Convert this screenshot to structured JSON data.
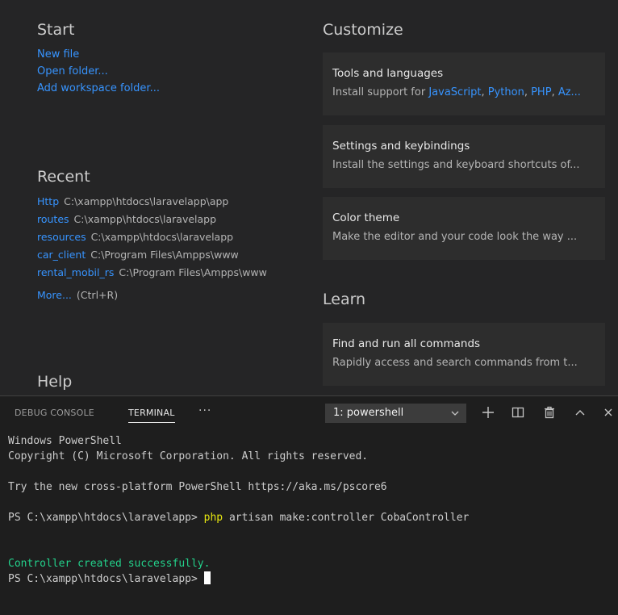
{
  "welcome": {
    "start": {
      "title": "Start",
      "links": [
        "New file",
        "Open folder...",
        "Add workspace folder..."
      ]
    },
    "recent": {
      "title": "Recent",
      "items": [
        {
          "name": "Http",
          "path": "C:\\xampp\\htdocs\\laravelapp\\app"
        },
        {
          "name": "routes",
          "path": "C:\\xampp\\htdocs\\laravelapp"
        },
        {
          "name": "resources",
          "path": "C:\\xampp\\htdocs\\laravelapp"
        },
        {
          "name": "car_client",
          "path": "C:\\Program Files\\Ampps\\www"
        },
        {
          "name": "rental_mobil_rs",
          "path": "C:\\Program Files\\Ampps\\www"
        }
      ],
      "more_label": "More...",
      "more_shortcut": "(Ctrl+R)"
    },
    "help": {
      "title": "Help"
    },
    "customize": {
      "title": "Customize",
      "cards": {
        "tools": {
          "title": "Tools and languages",
          "desc_prefix": "Install support for ",
          "links": [
            "JavaScript",
            "Python",
            "PHP",
            "Az..."
          ]
        },
        "settings": {
          "title": "Settings and keybindings",
          "desc": "Install the settings and keyboard shortcuts of..."
        },
        "theme": {
          "title": "Color theme",
          "desc": "Make the editor and your code look the way ..."
        }
      }
    },
    "learn": {
      "title": "Learn",
      "cards": {
        "commands": {
          "title": "Find and run all commands",
          "desc": "Rapidly access and search commands from t..."
        }
      }
    }
  },
  "panel": {
    "tabs": {
      "debug": "DEBUG CONSOLE",
      "terminal": "TERMINAL",
      "more": "···"
    },
    "terminal_selector": "1: powershell",
    "icons": {
      "new_terminal": "plus-icon",
      "split": "split-icon",
      "kill": "trash-icon",
      "maximize": "chevron-up-icon",
      "close": "close-icon"
    }
  },
  "terminal": {
    "lines": {
      "l1": "Windows PowerShell",
      "l2": "Copyright (C) Microsoft Corporation. All rights reserved.",
      "l4": "Try the new cross-platform PowerShell https://aka.ms/pscore6",
      "prompt1": "PS C:\\xampp\\htdocs\\laravelapp> ",
      "cmd_keyword": "php",
      "cmd_rest": " artisan make:controller CobaController",
      "success": "Controller created successfully.",
      "prompt2": "PS C:\\xampp\\htdocs\\laravelapp> "
    }
  },
  "colors": {
    "link": "#3794ff",
    "success": "#23d18b",
    "keyword": "#e5e510",
    "background": "#1e1e1e",
    "welcome_background": "#252526",
    "card_background": "#2d2d2d"
  }
}
